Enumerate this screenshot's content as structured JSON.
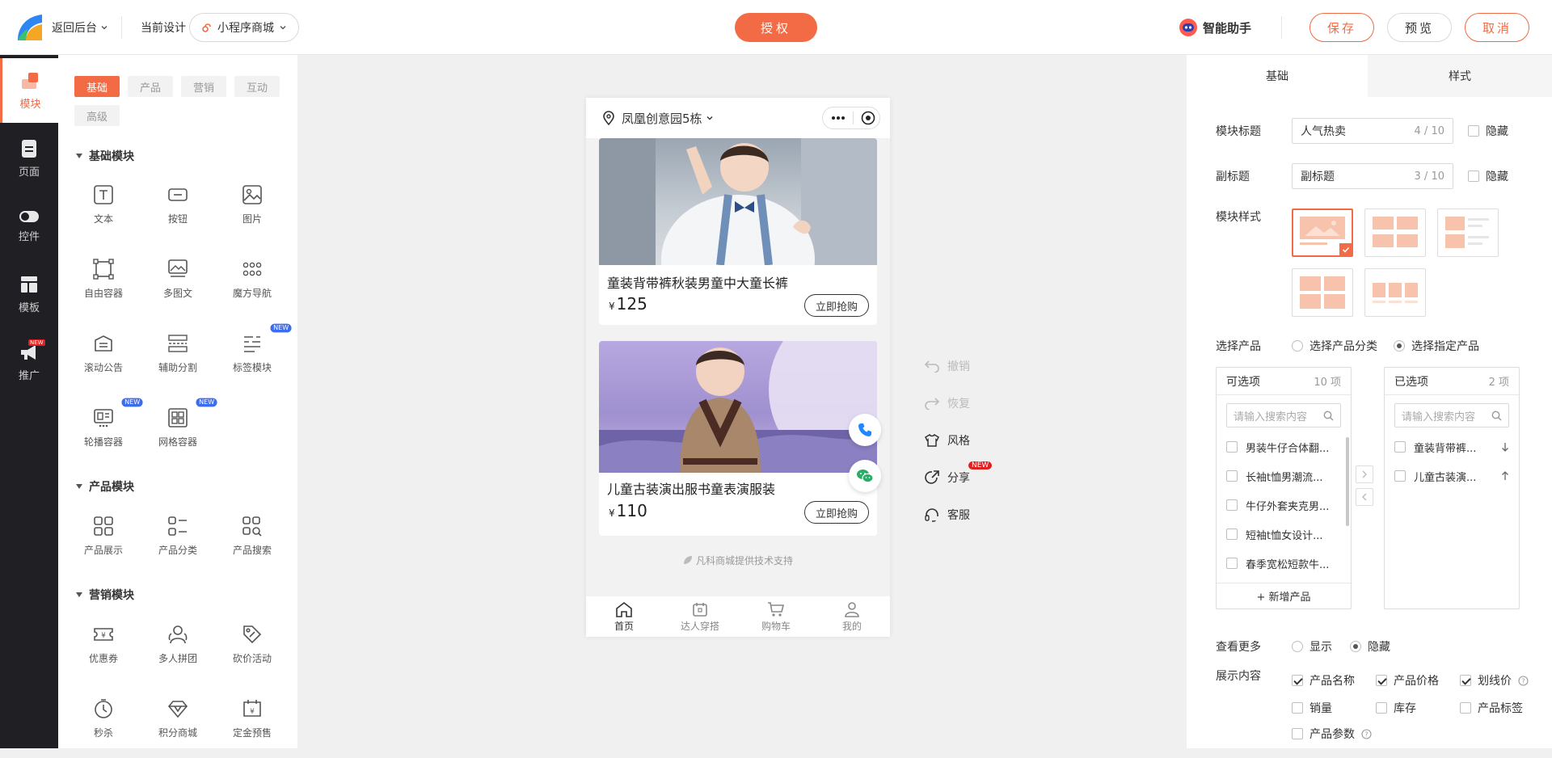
{
  "header": {
    "back_label": "返回后台",
    "current_design_label": "当前设计",
    "design_select": "小程序商城",
    "auth_label": "授权",
    "assistant_label": "智能助手",
    "save_label": "保存",
    "preview_label": "预览",
    "cancel_label": "取消"
  },
  "rail": {
    "items": [
      {
        "label": "模块",
        "icon": "module-icon"
      },
      {
        "label": "页面",
        "icon": "page-icon"
      },
      {
        "label": "控件",
        "icon": "toggle-icon"
      },
      {
        "label": "模板",
        "icon": "template-icon"
      },
      {
        "label": "推广",
        "icon": "megaphone-icon",
        "badge": "NEW"
      }
    ]
  },
  "module_panel": {
    "tabs": [
      "基础",
      "产品",
      "营销",
      "互动",
      "高级"
    ],
    "sections": [
      {
        "title": "基础模块",
        "items": [
          {
            "label": "文本",
            "icon": "text-icon"
          },
          {
            "label": "按钮",
            "icon": "button-icon"
          },
          {
            "label": "图片",
            "icon": "image-icon"
          },
          {
            "label": "自由容器",
            "icon": "free-container-icon"
          },
          {
            "label": "多图文",
            "icon": "multi-image-text-icon"
          },
          {
            "label": "魔方导航",
            "icon": "cube-nav-icon"
          },
          {
            "label": "滚动公告",
            "icon": "scroll-notice-icon"
          },
          {
            "label": "辅助分割",
            "icon": "divider-icon"
          },
          {
            "label": "标签模块",
            "icon": "tag-module-icon",
            "badge": "NEW"
          },
          {
            "label": "轮播容器",
            "icon": "carousel-icon",
            "badge": "NEW"
          },
          {
            "label": "网格容器",
            "icon": "grid-container-icon",
            "badge": "NEW"
          }
        ]
      },
      {
        "title": "产品模块",
        "items": [
          {
            "label": "产品展示",
            "icon": "product-display-icon"
          },
          {
            "label": "产品分类",
            "icon": "product-category-icon"
          },
          {
            "label": "产品搜索",
            "icon": "product-search-icon"
          }
        ]
      },
      {
        "title": "营销模块",
        "items": [
          {
            "label": "优惠券",
            "icon": "coupon-icon"
          },
          {
            "label": "多人拼团",
            "icon": "group-buy-icon"
          },
          {
            "label": "砍价活动",
            "icon": "bargain-icon"
          },
          {
            "label": "秒杀",
            "icon": "flash-sale-icon"
          },
          {
            "label": "积分商城",
            "icon": "points-mall-icon"
          },
          {
            "label": "定金预售",
            "icon": "presale-icon"
          }
        ]
      }
    ]
  },
  "phone": {
    "location": "凤凰创意园5栋",
    "products": [
      {
        "name": "童装背带裤秋装男童中大童长裤",
        "currency": "¥",
        "price": "125",
        "buy_label": "立即抢购"
      },
      {
        "name": "儿童古装演出服书童表演服装",
        "currency": "¥",
        "price": "110",
        "buy_label": "立即抢购"
      }
    ],
    "footer_text": "凡科商城提供技术支持",
    "tabbar": [
      {
        "label": "首页",
        "icon": "home-icon"
      },
      {
        "label": "达人穿搭",
        "icon": "calendar-icon"
      },
      {
        "label": "购物车",
        "icon": "cart-icon"
      },
      {
        "label": "我的",
        "icon": "user-icon"
      }
    ]
  },
  "tools": [
    {
      "label": "撤销",
      "icon": "undo-icon"
    },
    {
      "label": "恢复",
      "icon": "redo-icon"
    },
    {
      "label": "风格",
      "icon": "shirt-icon"
    },
    {
      "label": "分享",
      "icon": "share-icon",
      "badge": "NEW"
    },
    {
      "label": "客服",
      "icon": "headset-icon"
    }
  ],
  "right_panel": {
    "tabs": [
      "基础",
      "样式"
    ],
    "module_title": {
      "label": "模块标题",
      "value": "人气热卖",
      "count": "4 / 10",
      "hide_label": "隐藏"
    },
    "subtitle": {
      "label": "副标题",
      "value": "副标题",
      "count": "3 / 10",
      "hide_label": "隐藏"
    },
    "module_style_label": "模块样式",
    "select_product": {
      "label": "选择产品",
      "options": [
        "选择产品分类",
        "选择指定产品"
      ],
      "selected": 1
    },
    "available": {
      "title": "可选项",
      "count": "10 项",
      "search_placeholder": "请输入搜索内容",
      "items": [
        "男装牛仔合体翻...",
        "长袖t恤男潮流...",
        "牛仔外套夹克男...",
        "短袖t恤女设计...",
        "春季宽松短款牛..."
      ],
      "add_label": "+ 新增产品"
    },
    "selected_list": {
      "title": "已选项",
      "count": "2 项",
      "search_placeholder": "请输入搜索内容",
      "items": [
        "童装背带裤...",
        "儿童古装演..."
      ]
    },
    "view_more": {
      "label": "查看更多",
      "options": [
        "显示",
        "隐藏"
      ],
      "selected": 1
    },
    "display": {
      "label": "展示内容",
      "options": [
        {
          "label": "产品名称",
          "checked": true
        },
        {
          "label": "产品价格",
          "checked": true
        },
        {
          "label": "划线价",
          "checked": true
        },
        {
          "label": "销量",
          "checked": false
        },
        {
          "label": "库存",
          "checked": false
        },
        {
          "label": "产品标签",
          "checked": false
        },
        {
          "label": "产品参数",
          "checked": false
        }
      ]
    },
    "accent_color": "#f26b45"
  }
}
